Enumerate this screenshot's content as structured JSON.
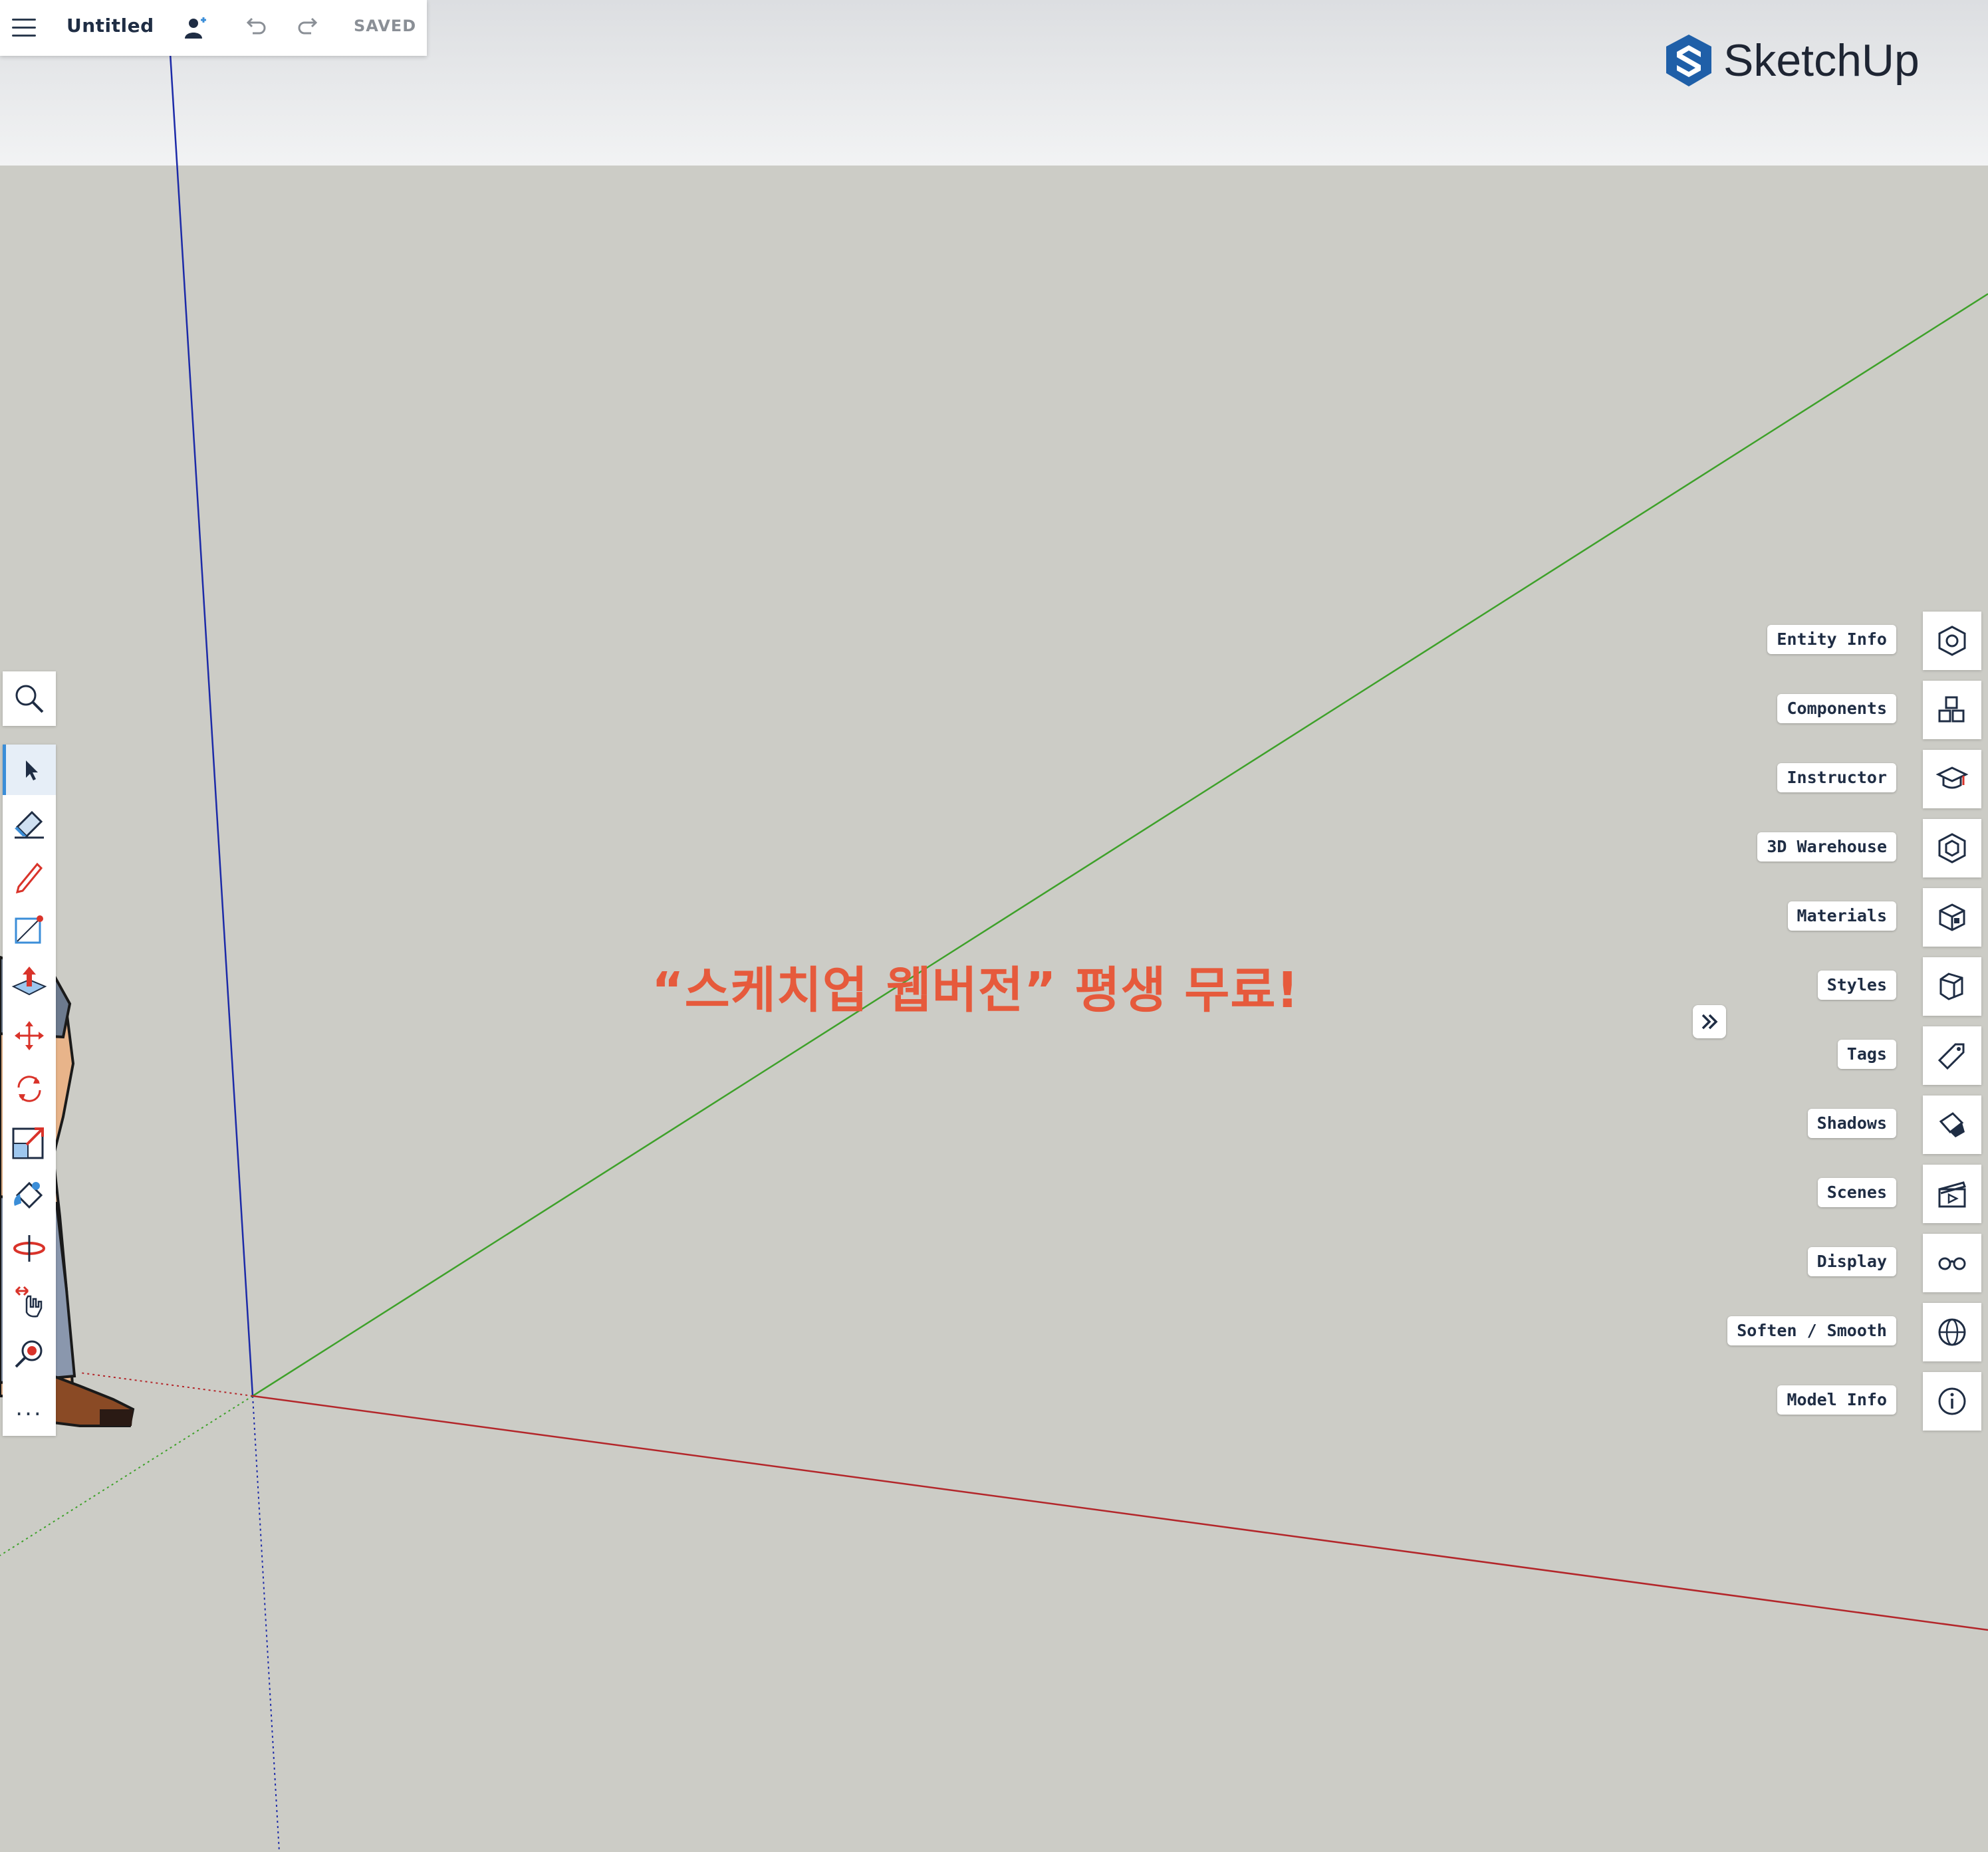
{
  "app": {
    "name": "SketchUp",
    "document_title": "Untitled",
    "save_status": "SAVED"
  },
  "toolbar_top": {
    "menu_icon": "hamburger-menu-icon",
    "share_icon": "add-user-icon",
    "undo_icon": "undo-icon",
    "redo_icon": "redo-icon"
  },
  "left_tools": [
    {
      "name": "search-tool",
      "icon": "magnifier-icon"
    },
    {
      "name": "select-tool",
      "icon": "arrow-cursor-icon",
      "active": true
    },
    {
      "name": "eraser-tool",
      "icon": "eraser-icon"
    },
    {
      "name": "pencil-tool",
      "icon": "pencil-icon"
    },
    {
      "name": "rectangle-tool",
      "icon": "rectangle-icon"
    },
    {
      "name": "push-pull-tool",
      "icon": "push-pull-icon"
    },
    {
      "name": "move-tool",
      "icon": "move-arrows-icon"
    },
    {
      "name": "rotate-tool",
      "icon": "rotate-icon"
    },
    {
      "name": "scale-tool",
      "icon": "scale-icon"
    },
    {
      "name": "paint-bucket-tool",
      "icon": "paint-bucket-icon"
    },
    {
      "name": "orbit-tool",
      "icon": "orbit-icon"
    },
    {
      "name": "pan-tool",
      "icon": "pan-hand-icon"
    },
    {
      "name": "zoom-extents-tool",
      "icon": "zoom-extents-icon"
    },
    {
      "name": "more-tools",
      "label": "..."
    }
  ],
  "panels": [
    {
      "label": "Entity Info",
      "icon": "entity-info-icon"
    },
    {
      "label": "Components",
      "icon": "components-icon"
    },
    {
      "label": "Instructor",
      "icon": "graduation-cap-icon"
    },
    {
      "label": "3D Warehouse",
      "icon": "warehouse-icon"
    },
    {
      "label": "Materials",
      "icon": "materials-cube-icon"
    },
    {
      "label": "Styles",
      "icon": "styles-cube-icon"
    },
    {
      "label": "Tags",
      "icon": "tag-icon"
    },
    {
      "label": "Shadows",
      "icon": "shadows-icon"
    },
    {
      "label": "Scenes",
      "icon": "clapperboard-icon"
    },
    {
      "label": "Display",
      "icon": "glasses-icon"
    },
    {
      "label": "Soften / Smooth",
      "icon": "soften-sphere-icon"
    },
    {
      "label": "Model Info",
      "icon": "info-circle-icon"
    }
  ],
  "collapse_panel_icon": "double-chevron-right-icon",
  "overlay_text": "“스케치업 웹버전” 평생 무료!",
  "colors": {
    "accent_blue": "#3b8ed8",
    "axis_red": "#c0272d",
    "axis_green": "#3ea12a",
    "axis_blue": "#1c2aa8",
    "promo_red": "#e65a3c",
    "ground": "#ccccc6"
  }
}
